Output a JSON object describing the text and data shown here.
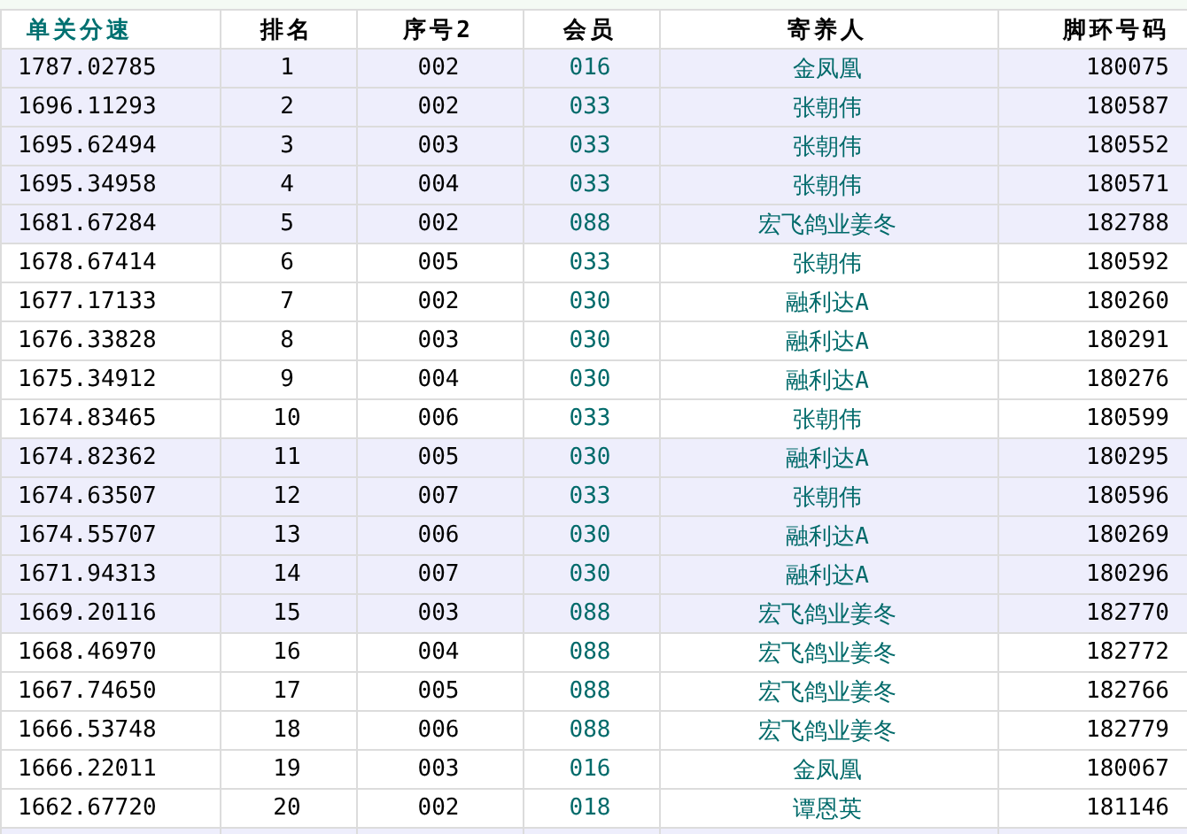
{
  "table": {
    "columns": [
      {
        "label": "单关分速",
        "color": "#007070"
      },
      {
        "label": "排名",
        "color": "#000000"
      },
      {
        "label": "序号2",
        "color": "#000000"
      },
      {
        "label": "会员",
        "color": "#000000"
      },
      {
        "label": "寄养人",
        "color": "#000000"
      },
      {
        "label": "脚环号码",
        "color": "#000000"
      }
    ],
    "rows": [
      {
        "highlighted": true,
        "cells": [
          "1787.02785",
          "1",
          "002",
          "016",
          "金凤凰",
          "180075"
        ]
      },
      {
        "highlighted": true,
        "cells": [
          "1696.11293",
          "2",
          "002",
          "033",
          "张朝伟",
          "180587"
        ]
      },
      {
        "highlighted": true,
        "cells": [
          "1695.62494",
          "3",
          "003",
          "033",
          "张朝伟",
          "180552"
        ]
      },
      {
        "highlighted": true,
        "cells": [
          "1695.34958",
          "4",
          "004",
          "033",
          "张朝伟",
          "180571"
        ]
      },
      {
        "highlighted": true,
        "cells": [
          "1681.67284",
          "5",
          "002",
          "088",
          "宏飞鸽业姜冬",
          "182788"
        ]
      },
      {
        "highlighted": false,
        "cells": [
          "1678.67414",
          "6",
          "005",
          "033",
          "张朝伟",
          "180592"
        ]
      },
      {
        "highlighted": false,
        "cells": [
          "1677.17133",
          "7",
          "002",
          "030",
          "融利达A",
          "180260"
        ]
      },
      {
        "highlighted": false,
        "cells": [
          "1676.33828",
          "8",
          "003",
          "030",
          "融利达A",
          "180291"
        ]
      },
      {
        "highlighted": false,
        "cells": [
          "1675.34912",
          "9",
          "004",
          "030",
          "融利达A",
          "180276"
        ]
      },
      {
        "highlighted": false,
        "cells": [
          "1674.83465",
          "10",
          "006",
          "033",
          "张朝伟",
          "180599"
        ]
      },
      {
        "highlighted": true,
        "cells": [
          "1674.82362",
          "11",
          "005",
          "030",
          "融利达A",
          "180295"
        ]
      },
      {
        "highlighted": true,
        "cells": [
          "1674.63507",
          "12",
          "007",
          "033",
          "张朝伟",
          "180596"
        ]
      },
      {
        "highlighted": true,
        "cells": [
          "1674.55707",
          "13",
          "006",
          "030",
          "融利达A",
          "180269"
        ]
      },
      {
        "highlighted": true,
        "cells": [
          "1671.94313",
          "14",
          "007",
          "030",
          "融利达A",
          "180296"
        ]
      },
      {
        "highlighted": true,
        "cells": [
          "1669.20116",
          "15",
          "003",
          "088",
          "宏飞鸽业姜冬",
          "182770"
        ]
      },
      {
        "highlighted": false,
        "cells": [
          "1668.46970",
          "16",
          "004",
          "088",
          "宏飞鸽业姜冬",
          "182772"
        ]
      },
      {
        "highlighted": false,
        "cells": [
          "1667.74650",
          "17",
          "005",
          "088",
          "宏飞鸽业姜冬",
          "182766"
        ]
      },
      {
        "highlighted": false,
        "cells": [
          "1666.53748",
          "18",
          "006",
          "088",
          "宏飞鸽业姜冬",
          "182779"
        ]
      },
      {
        "highlighted": false,
        "cells": [
          "1666.22011",
          "19",
          "003",
          "016",
          "金凤凰",
          "180067"
        ]
      },
      {
        "highlighted": false,
        "cells": [
          "1662.67720",
          "20",
          "002",
          "018",
          "谭恩英",
          "181146"
        ]
      }
    ]
  }
}
